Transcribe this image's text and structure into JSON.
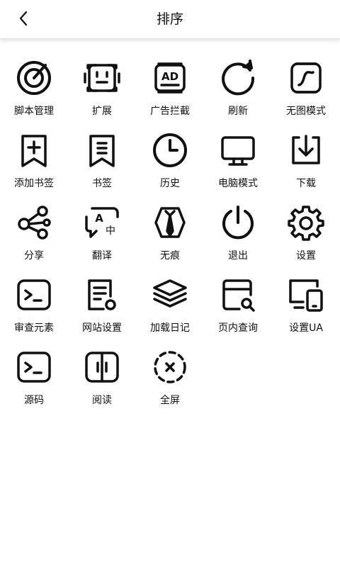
{
  "header": {
    "title": "排序"
  },
  "items": [
    {
      "label": "脚本管理",
      "icon": "script-manager-icon"
    },
    {
      "label": "扩展",
      "icon": "extension-icon"
    },
    {
      "label": "广告拦截",
      "icon": "ad-block-icon"
    },
    {
      "label": "刷新",
      "icon": "refresh-icon"
    },
    {
      "label": "无图模式",
      "icon": "no-image-mode-icon"
    },
    {
      "label": "添加书签",
      "icon": "add-bookmark-icon"
    },
    {
      "label": "书签",
      "icon": "bookmark-icon"
    },
    {
      "label": "历史",
      "icon": "history-icon"
    },
    {
      "label": "电脑模式",
      "icon": "desktop-mode-icon"
    },
    {
      "label": "下载",
      "icon": "download-icon"
    },
    {
      "label": "分享",
      "icon": "share-icon"
    },
    {
      "label": "翻译",
      "icon": "translate-icon"
    },
    {
      "label": "无痕",
      "icon": "incognito-icon"
    },
    {
      "label": "退出",
      "icon": "power-icon"
    },
    {
      "label": "设置",
      "icon": "gear-icon"
    },
    {
      "label": "审查元素",
      "icon": "inspect-element-icon"
    },
    {
      "label": "网站设置",
      "icon": "site-settings-icon"
    },
    {
      "label": "加载日记",
      "icon": "load-log-icon"
    },
    {
      "label": "页内查询",
      "icon": "find-in-page-icon"
    },
    {
      "label": "设置UA",
      "icon": "user-agent-icon"
    },
    {
      "label": "源码",
      "icon": "source-code-icon"
    },
    {
      "label": "阅读",
      "icon": "reader-icon"
    },
    {
      "label": "全屏",
      "icon": "fullscreen-icon"
    }
  ]
}
